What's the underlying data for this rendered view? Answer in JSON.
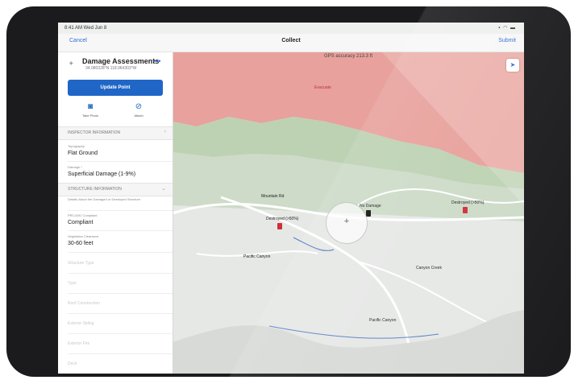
{
  "status": {
    "time": "8:41 AM Wed Jun 8",
    "indicators": "▪ ◠ ▬"
  },
  "nav": {
    "cancel": "Cancel",
    "title": "Collect",
    "submit": "Submit"
  },
  "map": {
    "gps_text": "GPS accuracy 213.3 ft",
    "fire_zone_label": "Evacuate",
    "markers": [
      {
        "label": "Destroyed (>50%)",
        "color": "#d0303a"
      },
      {
        "label": "No Damage",
        "color": "#111111"
      },
      {
        "label": "Destroyed (>50%)",
        "color": "#d0303a"
      }
    ],
    "road_labels": [
      "Mountain Rd",
      "Pacific Canyon",
      "Pacific Canyon",
      "Canyon Creek"
    ]
  },
  "panel": {
    "layer_title": "Damage Assessments",
    "layer_coords": "34.080328°N 118.964303°W",
    "more_label": "•••",
    "update_label": "Update Point",
    "actions": [
      {
        "label": "Take Photo",
        "icon": "camera-icon"
      },
      {
        "label": "Attach",
        "icon": "paperclip-icon"
      }
    ],
    "sections": [
      {
        "title": "INSPECTOR INFORMATION",
        "chevron": "›"
      },
      {
        "title": "STRUCTURE INFORMATION",
        "chevron": "⌄"
      }
    ],
    "inspector_fields": [
      {
        "label": "Topography",
        "value": "Flat Ground"
      },
      {
        "label": "Damage *",
        "value": "Superficial Damage (1-9%)"
      }
    ],
    "structure_fields": [
      {
        "label": "Details About the Damaged or Destroyed Structure",
        "value": ""
      },
      {
        "label": "PRC4291 Compliant",
        "value": "Compliant"
      },
      {
        "label": "Vegetation Clearance",
        "value": "30-60 feet"
      }
    ],
    "empty_fields": [
      "Structure Type",
      "Type",
      "Roof Construction",
      "Exterior Siding",
      "Exterior Fire",
      "Deck"
    ]
  },
  "colors": {
    "accent": "#1f66c7",
    "fire_zone": "#e8a19c",
    "vegetation": "#bdd2b3",
    "device": "#1b1b1d"
  }
}
